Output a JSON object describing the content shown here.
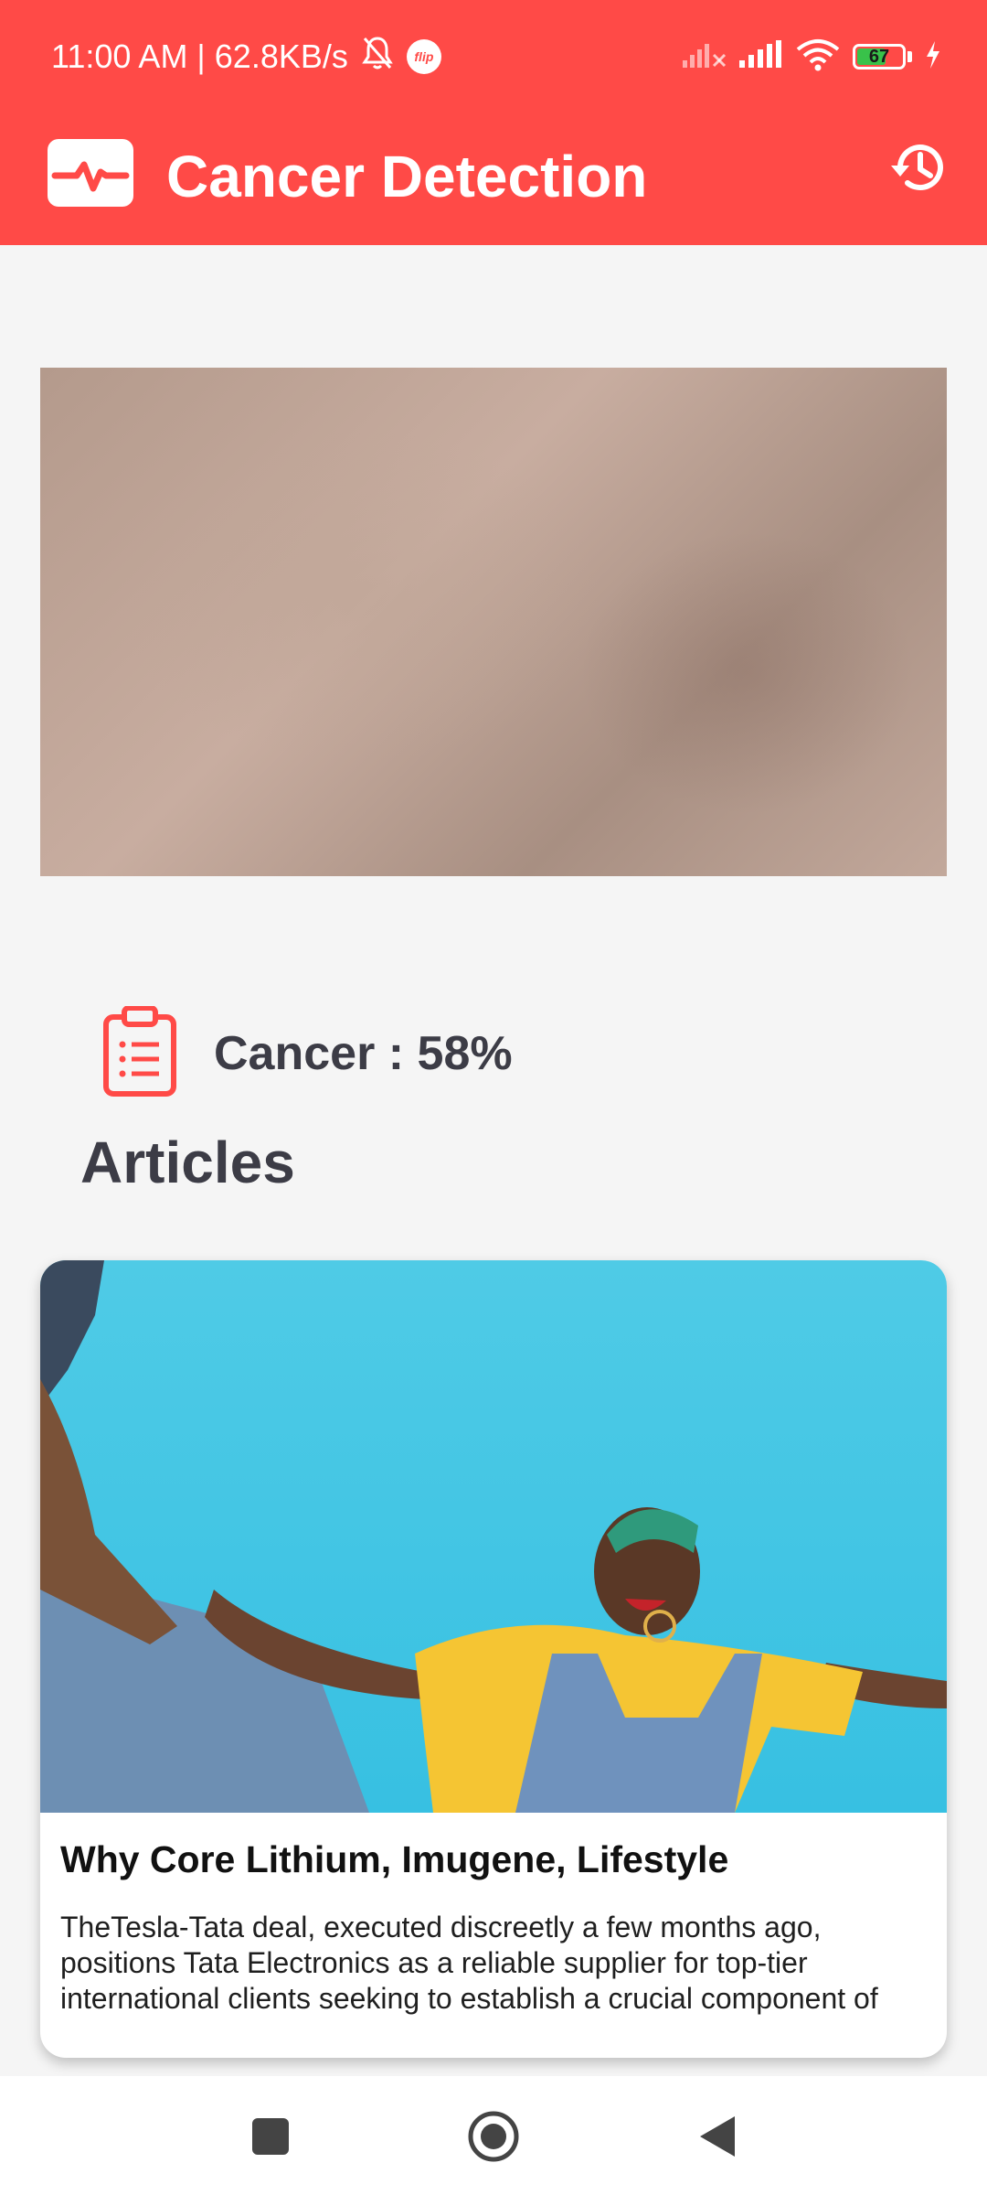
{
  "status_bar": {
    "time_speed": "11:00 AM | 62.8KB/s",
    "flip_badge": "flip",
    "battery_percent": "67",
    "battery_level": 0.67,
    "icons": [
      "bell-off-icon",
      "signal-off-icon",
      "signal-icon",
      "wifi-icon",
      "battery-icon",
      "charging-icon"
    ]
  },
  "app_bar": {
    "title": "Cancer Detection",
    "logo_icon": "heartbeat-icon",
    "history_icon": "history-icon"
  },
  "result": {
    "icon": "clipboard-icon",
    "text": "Cancer : 58%"
  },
  "articles": {
    "heading": "Articles",
    "items": [
      {
        "title": "Why Core Lithium, Imugene, Lifestyle",
        "description": "TheTesla-Tata deal, executed discreetly a few months ago, positions Tata Electronics as a reliable supplier for top-tier international clients seeking to establish a crucial component of"
      }
    ]
  },
  "nav": {
    "recents_icon": "square-icon",
    "home_icon": "home-circle-icon",
    "back_icon": "back-triangle-icon"
  },
  "colors": {
    "accent": "#ff4a47",
    "heading_text": "#3c3c46",
    "background": "#f5f5f5"
  }
}
